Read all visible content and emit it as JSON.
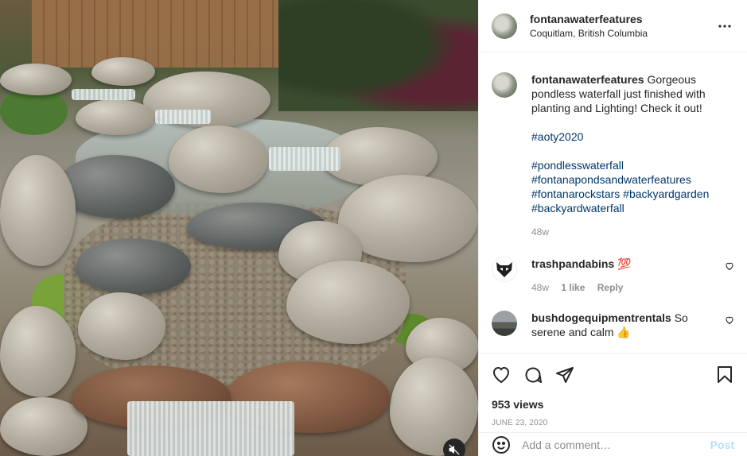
{
  "post": {
    "author": "fontanawaterfeatures",
    "location": "Coquitlam, British Columbia",
    "more_icon": "more-horizontal-icon"
  },
  "caption": {
    "username": "fontanawaterfeatures",
    "text_line1": "Gorgeous",
    "text_line2": "pondless waterfall just finished with",
    "text_line3": "planting and Lighting! Check it out!",
    "hashtags": [
      "#aoty2020",
      "#pondlesswaterfall",
      "#fontanapondsandwaterfeatures",
      "#fontanarockstars #backyardgarden",
      "#backyardwaterfall"
    ],
    "time": "48w"
  },
  "comments": [
    {
      "username": "trashpandabins",
      "text": "",
      "emoji": "💯",
      "time": "48w",
      "likes": "1 like",
      "reply": "Reply"
    },
    {
      "username": "bushdogequipmentrentals",
      "text": "So serene and calm",
      "emoji": "👍",
      "line1": "So",
      "line2": "serene and calm"
    }
  ],
  "engagement": {
    "views": "953 views",
    "date": "June 23, 2020"
  },
  "composer": {
    "placeholder": "Add a comment…",
    "post_label": "Post"
  },
  "icons": {
    "like": "heart-icon",
    "comment": "comment-icon",
    "share": "share-icon",
    "save": "bookmark-icon",
    "mute": "muted-speaker-icon",
    "emoji": "smiley-icon"
  },
  "colors": {
    "hashtag": "#00376b",
    "muted_text": "#8e8e8e",
    "post_button_disabled": "#b2dffc",
    "divider": "#efefef"
  }
}
